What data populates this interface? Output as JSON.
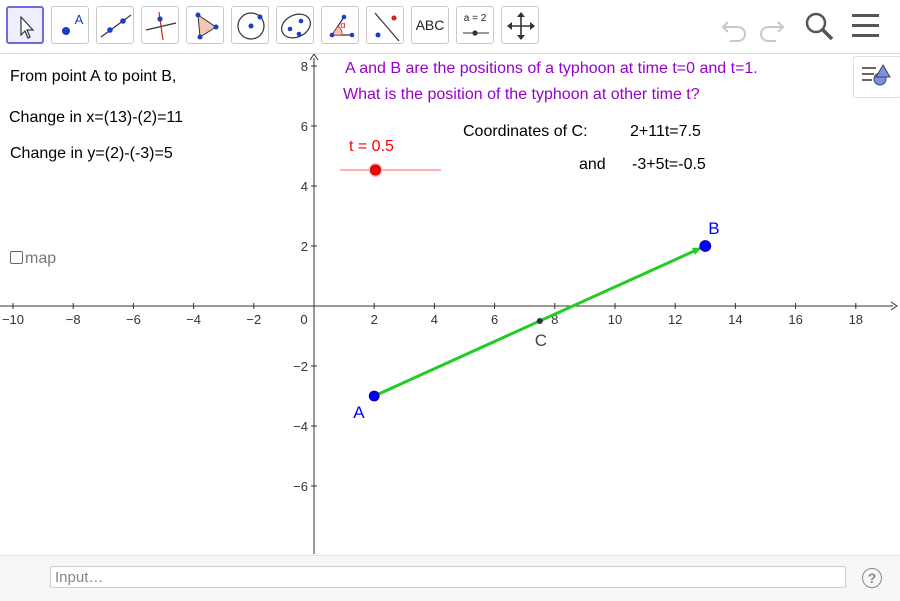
{
  "toolbar": {
    "tools": [
      {
        "name": "move-tool",
        "label": ""
      },
      {
        "name": "point-tool",
        "label": "A"
      },
      {
        "name": "line-tool",
        "label": ""
      },
      {
        "name": "perpendicular-line-tool",
        "label": ""
      },
      {
        "name": "polygon-tool",
        "label": ""
      },
      {
        "name": "circle-center-point-tool",
        "label": ""
      },
      {
        "name": "ellipse-tool",
        "label": ""
      },
      {
        "name": "angle-tool",
        "label": "α"
      },
      {
        "name": "reflect-tool",
        "label": ""
      },
      {
        "name": "text-tool",
        "label": "ABC"
      },
      {
        "name": "slider-tool",
        "label": "a = 2"
      },
      {
        "name": "move-graphics-view-tool",
        "label": ""
      }
    ],
    "active_tool": "move-tool",
    "right_icons": [
      "undo-icon",
      "redo-icon",
      "search-icon",
      "menu-icon"
    ]
  },
  "left_panel": {
    "line1": "From point A to point B,",
    "line2": "Change in x=(13)-(2)=11",
    "line3": "Change in y=(2)-(-3)=5",
    "checkbox_label": "map",
    "checkbox_checked": false
  },
  "problem": {
    "line1": "A and B are the positions of a typhoon at time t=0 and t=1.",
    "line2": "What is the position of the typhoon at other time t?"
  },
  "slider": {
    "label": "t = 0.5",
    "value": 0.5,
    "min": 0,
    "max": 1
  },
  "coords": {
    "label": "Coordinates of C:",
    "x_expr": "2+11t=7.5",
    "and": "and",
    "y_expr": "-3+5t=-0.5"
  },
  "graph": {
    "x_ticks": [
      "−10",
      "−8",
      "−6",
      "−4",
      "−2",
      "0",
      "2",
      "4",
      "6",
      "8",
      "10",
      "12",
      "14",
      "16",
      "18"
    ],
    "x_tick_values": [
      -10,
      -8,
      -6,
      -4,
      -2,
      0,
      2,
      4,
      6,
      8,
      10,
      12,
      14,
      16,
      18
    ],
    "y_ticks": [
      "8",
      "6",
      "4",
      "2",
      "−2",
      "−4",
      "−6"
    ],
    "y_tick_values": [
      8,
      6,
      4,
      2,
      -2,
      -4,
      -6
    ],
    "points": {
      "A": {
        "label": "A",
        "x": 2,
        "y": -3
      },
      "B": {
        "label": "B",
        "x": 13,
        "y": 2
      },
      "C": {
        "label": "C",
        "x": 7.5,
        "y": -0.5
      }
    },
    "colors": {
      "vector": "#22cc22",
      "point": "#0000ff",
      "label_blue": "#0000ff",
      "slider": "#ff0000",
      "text_purple": "#9900cc"
    }
  },
  "input_bar": {
    "placeholder": "Input…",
    "help": "?"
  }
}
